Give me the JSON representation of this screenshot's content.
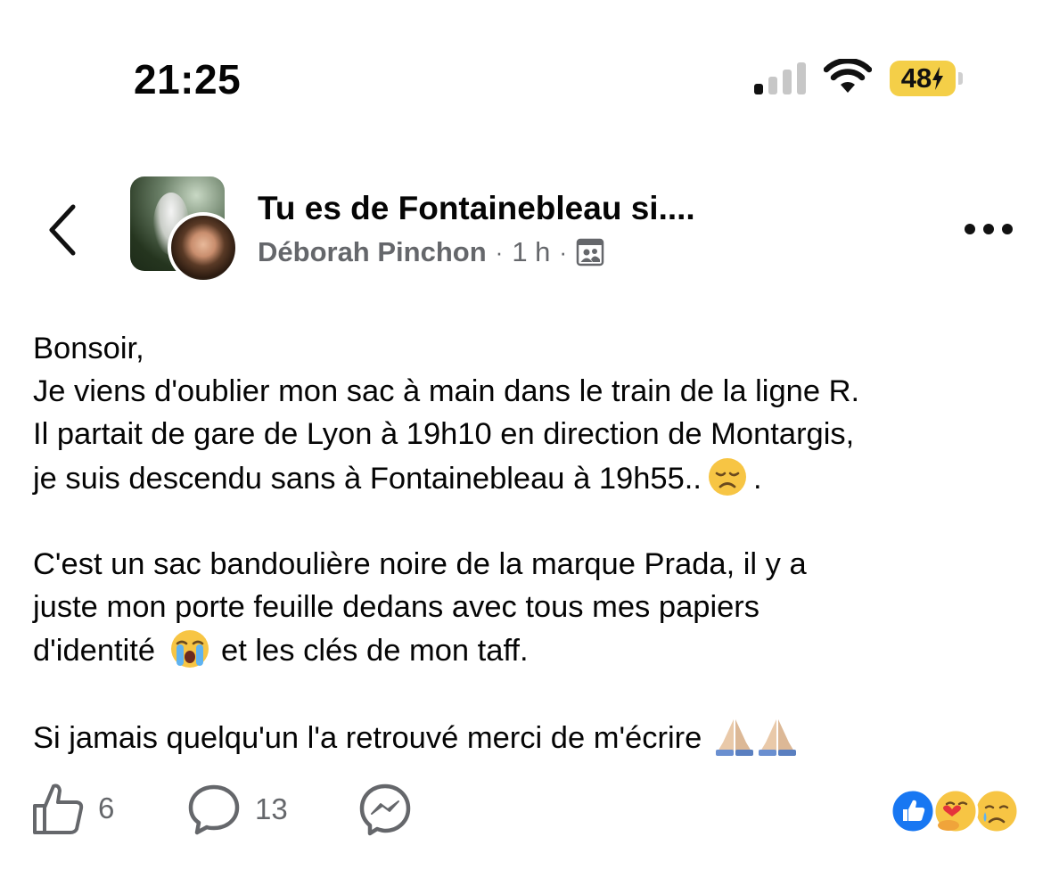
{
  "status_bar": {
    "time": "21:25",
    "battery": "48"
  },
  "header": {
    "group_title": "Tu es de Fontainebleau si....",
    "author": "Déborah Pinchon",
    "separator": "·",
    "time": "1 h"
  },
  "post": {
    "paragraphs": [
      {
        "lines": [
          "Bonsoir,",
          "Je viens d'oublier mon sac à main dans le train de la ligne R.",
          "Il partait de gare de Lyon à 19h10 en direction de Montargis,"
        ],
        "last_line_before_emoji": "je suis descendu sans à Fontainebleau à 19h55..",
        "last_line_after_emoji": "."
      },
      {
        "lines": [
          "C'est un sac bandoulière noire de la marque Prada, il y a",
          "juste mon porte feuille dedans avec tous mes papiers"
        ],
        "last_line_before_emoji": "d'identité",
        "last_line_after_emoji": "et les clés de mon taff."
      },
      {
        "last_line_before_emoji": "Si jamais quelqu'un l'a retrouvé merci de m'écrire"
      }
    ]
  },
  "actions": {
    "likes": "6",
    "comments": "13"
  },
  "icons": {
    "back": "chevron-left-icon",
    "more": "more-horizontal-icon",
    "audience": "group-members-icon",
    "like": "thumbs-up-icon",
    "comment": "comment-bubble-icon",
    "share": "messenger-icon",
    "reactions": [
      "like-reaction-icon",
      "care-reaction-icon",
      "sad-reaction-icon"
    ]
  },
  "colors": {
    "text": "#050505",
    "secondary": "#65676b",
    "battery": "#f4cf48",
    "like_blue": "#1877f2"
  }
}
